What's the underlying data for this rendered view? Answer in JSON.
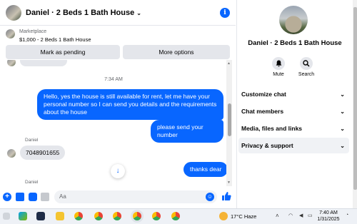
{
  "header": {
    "title": "Daniel · 2 Beds 1 Bath House",
    "info_icon_glyph": "i"
  },
  "listing": {
    "label": "Marketplace",
    "description": "$1,000 - 2 Beds 1 Bath House"
  },
  "actions": {
    "pending_label": "Mark as pending",
    "more_label": "More options"
  },
  "messages": {
    "timestamp": "7:34 AM",
    "outgoing_1": "Hello, yes the house is still available for rent, let me have your personal number so I can send you details and the requirements about the house",
    "outgoing_2": "please send your number",
    "sender_1": "Daniel",
    "incoming_1": "7048901655",
    "outgoing_3": "thanks dear",
    "sender_2": "Daniel"
  },
  "composer": {
    "placeholder": "Aa"
  },
  "side": {
    "name": "Daniel · 2 Beds 1 Bath House",
    "mute_label": "Mute",
    "search_label": "Search",
    "menu": [
      {
        "label": "Customize chat"
      },
      {
        "label": "Chat members"
      },
      {
        "label": "Media, files and links"
      },
      {
        "label": "Privacy & support"
      }
    ]
  },
  "taskbar": {
    "weather": "17°C  Haze",
    "time": "7:40 AM",
    "date": "1/31/2025"
  },
  "colors": {
    "accent": "#0866ff",
    "bubble_in": "#e4e6eb",
    "taskbar": "#eef1f6"
  }
}
